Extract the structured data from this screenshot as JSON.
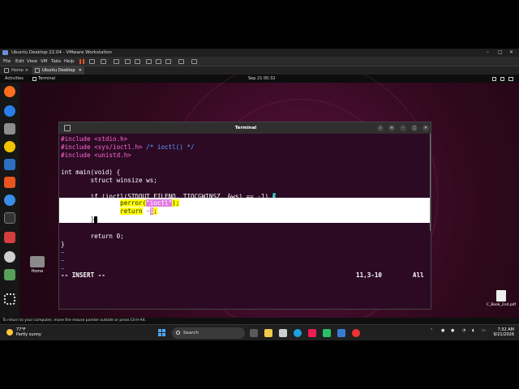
{
  "vmware": {
    "title": "Ubuntu Desktop 22.04 - VMware Workstation",
    "menu": [
      "File",
      "Edit",
      "View",
      "VM",
      "Tabs",
      "Help"
    ],
    "tabs": [
      {
        "label": "Home"
      },
      {
        "label": "Ubuntu Desktop 22.04"
      }
    ],
    "window_controls": [
      "–",
      "□",
      "✕"
    ]
  },
  "ubuntu": {
    "activities": "Activities",
    "app_name": "Terminal",
    "datetime": "Sep 21  00:32",
    "desktop_home_label": "Home",
    "desktop_pdf_label": "C_Book_2nd.pdf",
    "dock_icons": [
      "firefox-icon",
      "thunderbird-icon",
      "files-icon",
      "rhythmbox-icon",
      "writer-icon",
      "software-icon",
      "help-icon",
      "terminal-icon",
      "impress-icon",
      "dvd-icon",
      "trash-icon",
      "apps-grid-icon"
    ]
  },
  "terminal": {
    "title": "Terminal",
    "lines": {
      "l1_kw": "#include ",
      "l1_inc": "<stdio.h>",
      "l2_kw": "#include ",
      "l2_inc": "<sys/ioctl.h>",
      "l2_cmt": " /* ioctl() */",
      "l3_kw": "#include ",
      "l3_inc": "<unistd.h>",
      "l5": "int main(void) {",
      "l6": "        struct winsize ws;",
      "l8_pre": "        if (ioctl(STDOUT_FILENO, TIOCGWINSZ, &ws) == -1) ",
      "l8_brace": "{",
      "p1_pre": "                ",
      "p1_fn": "perror(",
      "p1_arg": "\"ioctl\"",
      "p1_post": ");",
      "p2_pre": "                ",
      "p2_kw": "return",
      "p2_mid": " -",
      "p2_num": "1",
      "p2_post": ";",
      "p3_pre": "        }",
      "l12": "        return 0;",
      "l13": "}",
      "tilde": "~"
    },
    "mode": "-- INSERT --",
    "position": "11,3-10",
    "scroll": "All"
  },
  "windows": {
    "vm_hint": "To return to your computer, move the mouse pointer outside or press Ctrl+Alt.",
    "weather_temp": "77°F",
    "weather_desc": "Partly sunny",
    "search_placeholder": "Search",
    "time": "7:32 AM",
    "date": "9/21/2026"
  }
}
